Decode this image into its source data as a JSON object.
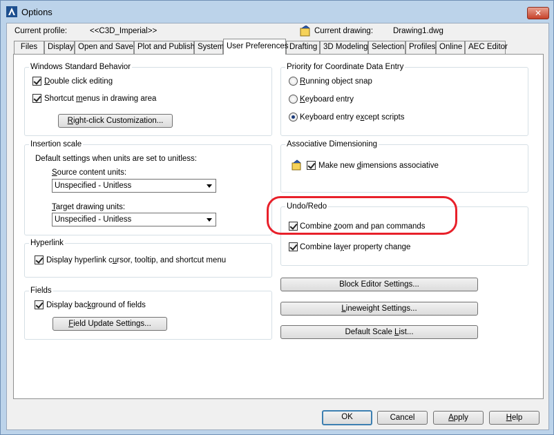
{
  "window": {
    "title": "Options",
    "close_label": "✕"
  },
  "profile": {
    "current_profile_label": "Current profile:",
    "current_profile_value": "<<C3D_Imperial>>",
    "current_drawing_label": "Current drawing:",
    "current_drawing_value": "Drawing1.dwg"
  },
  "tabs": [
    "Files",
    "Display",
    "Open and Save",
    "Plot and Publish",
    "System",
    "User Preferences",
    "Drafting",
    "3D Modeling",
    "Selection",
    "Profiles",
    "Online",
    "AEC Editor"
  ],
  "active_tab": "User Preferences",
  "windows_behavior": {
    "title": "Windows Standard Behavior",
    "double_click": {
      "pre": "",
      "key": "D",
      "post": "ouble click editing",
      "checked": true
    },
    "shortcut_menus": {
      "pre": "Shortcut ",
      "key": "m",
      "post": "enus in drawing area",
      "checked": true
    },
    "right_click_button": {
      "pre": "",
      "key": "R",
      "post": "ight-click Customization..."
    }
  },
  "insertion_scale": {
    "title": "Insertion scale",
    "desc": "Default settings when units are set to unitless:",
    "source_label": {
      "pre": "",
      "key": "S",
      "post": "ource content units:"
    },
    "source_value": "Unspecified - Unitless",
    "target_label": {
      "pre": "",
      "key": "T",
      "post": "arget drawing units:"
    },
    "target_value": "Unspecified - Unitless"
  },
  "hyperlink": {
    "title": "Hyperlink",
    "display": {
      "pre": "Display hyperlink c",
      "key": "u",
      "post": "rsor, tooltip, and shortcut menu",
      "checked": true
    }
  },
  "fields": {
    "title": "Fields",
    "display_bg": {
      "pre": "Display bac",
      "key": "k",
      "post": "ground of fields",
      "checked": true
    },
    "update_button": {
      "pre": "",
      "key": "F",
      "post": "ield Update Settings..."
    }
  },
  "priority": {
    "title": "Priority for Coordinate Data Entry",
    "options": [
      {
        "pre": "",
        "key": "R",
        "post": "unning object snap",
        "selected": false
      },
      {
        "pre": "",
        "key": "K",
        "post": "eyboard entry",
        "selected": false
      },
      {
        "pre": "Keyboard entry e",
        "key": "x",
        "post": "cept scripts",
        "selected": true
      }
    ]
  },
  "assoc_dim": {
    "title": "Associative Dimensioning",
    "make_new": {
      "pre": "Make new ",
      "key": "d",
      "post": "imensions associative",
      "checked": true
    }
  },
  "undo_redo": {
    "title": "Undo/Redo",
    "combine_zoom": {
      "pre": "Combine ",
      "key": "z",
      "post": "oom and pan commands",
      "checked": true
    },
    "combine_layer": {
      "pre": "Combine la",
      "key": "y",
      "post": "er property change",
      "checked": true
    }
  },
  "right_buttons": [
    {
      "pre": "Block Editor Settin",
      "key": "g",
      "post": "s..."
    },
    {
      "pre": "",
      "key": "L",
      "post": "ineweight Settings..."
    },
    {
      "pre": "Default Scale ",
      "key": "L",
      "post": "ist..."
    }
  ],
  "footer": {
    "ok": "OK",
    "cancel": "Cancel",
    "apply": {
      "pre": "",
      "key": "A",
      "post": "pply"
    },
    "help": {
      "pre": "",
      "key": "H",
      "post": "elp"
    }
  }
}
